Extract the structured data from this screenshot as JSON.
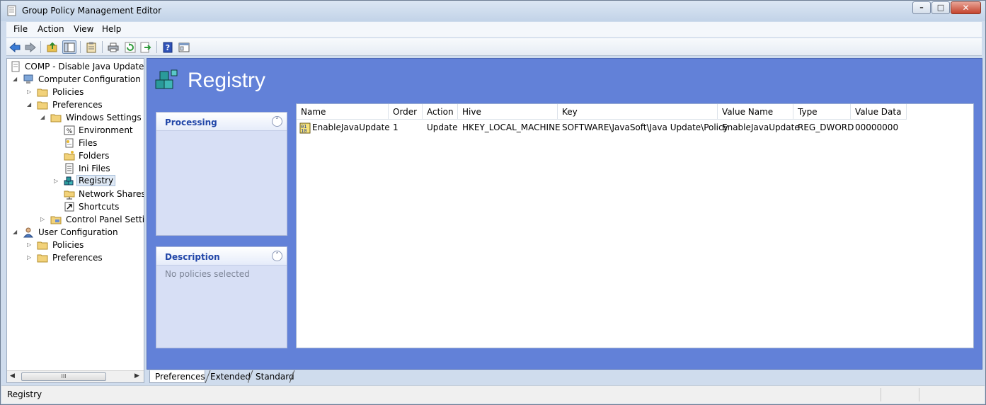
{
  "window": {
    "title": "Group Policy Management Editor",
    "minimize_glyph": "–",
    "maximize_glyph": "□",
    "close_glyph": "✕"
  },
  "menu": {
    "items": [
      {
        "label": "File"
      },
      {
        "label": "Action"
      },
      {
        "label": "View"
      },
      {
        "label": "Help"
      }
    ]
  },
  "toolbar": {
    "buttons": [
      {
        "name": "back-icon"
      },
      {
        "name": "forward-icon"
      },
      {
        "name": "up-folder-icon"
      },
      {
        "name": "show-hide-tree-icon",
        "pressed": true
      },
      {
        "name": "clipboard-icon"
      },
      {
        "name": "print-icon"
      },
      {
        "name": "refresh-icon"
      },
      {
        "name": "export-list-icon"
      },
      {
        "name": "help-icon"
      },
      {
        "name": "properties-icon"
      }
    ]
  },
  "tree": {
    "root": "COMP - Disable Java Updates [D",
    "computer_configuration": "Computer Configuration",
    "policies": "Policies",
    "preferences": "Preferences",
    "windows_settings": "Windows Settings",
    "environment": "Environment",
    "files": "Files",
    "folders": "Folders",
    "ini_files": "Ini Files",
    "registry": "Registry",
    "network_shares": "Network Shares",
    "shortcuts": "Shortcuts",
    "control_panel_settings": "Control Panel Setting",
    "user_configuration": "User Configuration",
    "user_policies": "Policies",
    "user_preferences": "Preferences",
    "scroll_grip": "III"
  },
  "main": {
    "title": "Registry",
    "processing": {
      "title": "Processing",
      "collapse_glyph": "˄"
    },
    "description": {
      "title": "Description",
      "collapse_glyph": "˄",
      "text": "No policies selected"
    }
  },
  "list": {
    "columns": [
      "Name",
      "Order",
      "Action",
      "Hive",
      "Key",
      "Value Name",
      "Type",
      "Value Data"
    ],
    "rows": [
      {
        "name": "EnableJavaUpdate",
        "order": "1",
        "action": "Update",
        "hive": "HKEY_LOCAL_MACHINE",
        "key": "SOFTWARE\\JavaSoft\\Java Update\\Policy",
        "value_name": "EnableJavaUpdate",
        "type": "REG_DWORD",
        "value_data": "00000000"
      }
    ]
  },
  "tabs": [
    {
      "label": "Preferences",
      "active": true
    },
    {
      "label": "Extended",
      "active": false
    },
    {
      "label": "Standard",
      "active": false
    }
  ],
  "status": {
    "text": "Registry"
  },
  "colors": {
    "pane_blue": "#6281d8",
    "header_text": "#2146a8",
    "window_frame": "#cfdced"
  }
}
